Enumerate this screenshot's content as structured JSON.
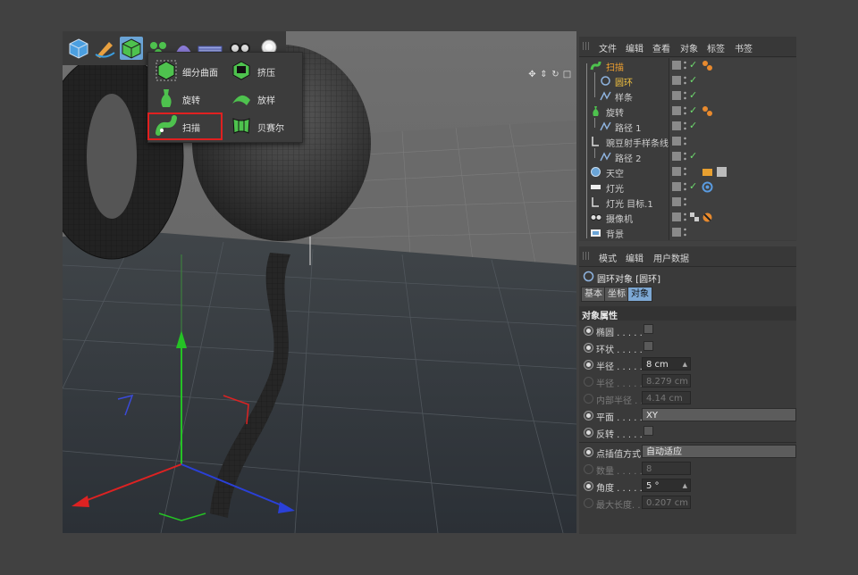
{
  "popup": {
    "items": [
      {
        "label": "细分曲面",
        "icon": "subdivision-surface-icon"
      },
      {
        "label": "挤压",
        "icon": "extrude-icon"
      },
      {
        "label": "旋转",
        "icon": "lathe-icon"
      },
      {
        "label": "放样",
        "icon": "loft-icon"
      },
      {
        "label": "扫描",
        "icon": "sweep-icon"
      },
      {
        "label": "贝赛尔",
        "icon": "bezier-icon"
      }
    ]
  },
  "object_manager": {
    "menu": [
      "文件",
      "编辑",
      "查看",
      "对象",
      "标签",
      "书签"
    ],
    "rows": [
      {
        "label": "扫描",
        "color": "#f0a030"
      },
      {
        "label": "圆环",
        "color": "#f0c040"
      },
      {
        "label": "样条",
        "color": "#cfcfcf"
      },
      {
        "label": "旋转",
        "color": "#cfcfcf"
      },
      {
        "label": "路径 1",
        "color": "#cfcfcf"
      },
      {
        "label": "豌豆射手样条线",
        "color": "#cfcfcf"
      },
      {
        "label": "路径 2",
        "color": "#cfcfcf"
      },
      {
        "label": "天空",
        "color": "#cfcfcf"
      },
      {
        "label": "灯光",
        "color": "#cfcfcf"
      },
      {
        "label": "灯光 目标.1",
        "color": "#cfcfcf"
      },
      {
        "label": "摄像机",
        "color": "#cfcfcf"
      },
      {
        "label": "背景",
        "color": "#cfcfcf"
      }
    ]
  },
  "attribute_manager": {
    "menu": [
      "模式",
      "编辑",
      "用户数据"
    ],
    "title": "圆环对象 [圆环]",
    "tabs": [
      "基本",
      "坐标",
      "对象"
    ],
    "section": "对象属性",
    "props": {
      "ellipse": "椭圆 . . . . .",
      "ring": "环状 . . . . .",
      "radius": "半径 . . . . .",
      "radius_value": "8 cm",
      "radius2": "半径 . . . . .",
      "radius2_value": "8.279 cm",
      "inner_radius": "内部半径 . .",
      "inner_radius_value": "4.14 cm",
      "plane": "平面 . . . . .",
      "plane_value": "XY",
      "reverse": "反转 . . . . .",
      "interp": "点插值方式",
      "interp_value": "自动适应",
      "count": "数量 . . . . .",
      "count_value": "8",
      "angle": "角度 . . . . .",
      "angle_value": "5 °",
      "max_len": "最大长度. . .",
      "max_len_value": "0.207 cm"
    }
  }
}
